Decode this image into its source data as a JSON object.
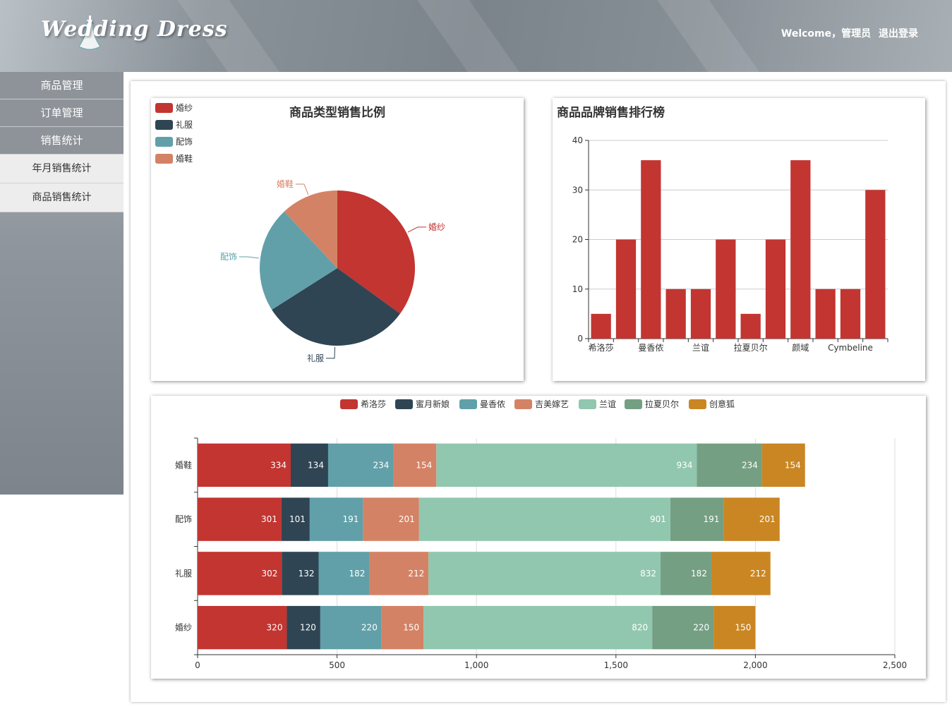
{
  "header": {
    "logo_text": "Wedding Dress",
    "welcome": "Welcome，管理员",
    "logout": "退出登录"
  },
  "sidebar": {
    "items": [
      {
        "label": "商品管理"
      },
      {
        "label": "订单管理"
      },
      {
        "label": "销售统计"
      },
      {
        "label": "年月销售统计"
      },
      {
        "label": "商品销售统计"
      }
    ]
  },
  "colors": {
    "palette": [
      "#c23531",
      "#2f4554",
      "#61a0a8",
      "#d48265",
      "#91c7ae",
      "#749f83",
      "#ca8622"
    ]
  },
  "chart_data": [
    {
      "type": "pie",
      "title": "商品类型销售比例",
      "legend": [
        "婚纱",
        "礼服",
        "配饰",
        "婚鞋"
      ],
      "legend_position": "top-left",
      "values": [
        35,
        31,
        22,
        12
      ],
      "colors": [
        "#c23531",
        "#2f4554",
        "#61a0a8",
        "#d48265"
      ]
    },
    {
      "type": "bar",
      "title": "商品品牌销售排行榜",
      "tick_labels": [
        "希洛莎",
        "曼香侬",
        "兰谊",
        "拉夏贝尔",
        "颜域",
        "Cymbeline"
      ],
      "values": [
        5,
        20,
        36,
        10,
        10,
        20,
        5,
        20,
        36,
        10,
        10,
        30
      ],
      "ylim": [
        0,
        40
      ],
      "yticks": [
        0,
        10,
        20,
        30,
        40
      ],
      "grid": true,
      "color": "#c23531"
    },
    {
      "type": "bar",
      "orientation": "horizontal",
      "stacked": true,
      "legend_position": "top-center",
      "categories": [
        "婚鞋",
        "配饰",
        "礼服",
        "婚纱"
      ],
      "series": [
        {
          "name": "希洛莎",
          "values": [
            334,
            301,
            302,
            320
          ]
        },
        {
          "name": "蜜月新娘",
          "values": [
            134,
            101,
            132,
            120
          ]
        },
        {
          "name": "曼香侬",
          "values": [
            234,
            191,
            182,
            220
          ]
        },
        {
          "name": "吉美嫁艺",
          "values": [
            154,
            201,
            212,
            150
          ]
        },
        {
          "name": "兰谊",
          "values": [
            934,
            901,
            832,
            820
          ]
        },
        {
          "name": "拉夏贝尔",
          "values": [
            234,
            191,
            182,
            220
          ]
        },
        {
          "name": "创意狐",
          "values": [
            154,
            201,
            212,
            150
          ]
        }
      ],
      "xlim": [
        0,
        2500
      ],
      "xticks": [
        "0",
        "500",
        "1,000",
        "1,500",
        "2,000",
        "2,500"
      ],
      "grid": true
    }
  ]
}
